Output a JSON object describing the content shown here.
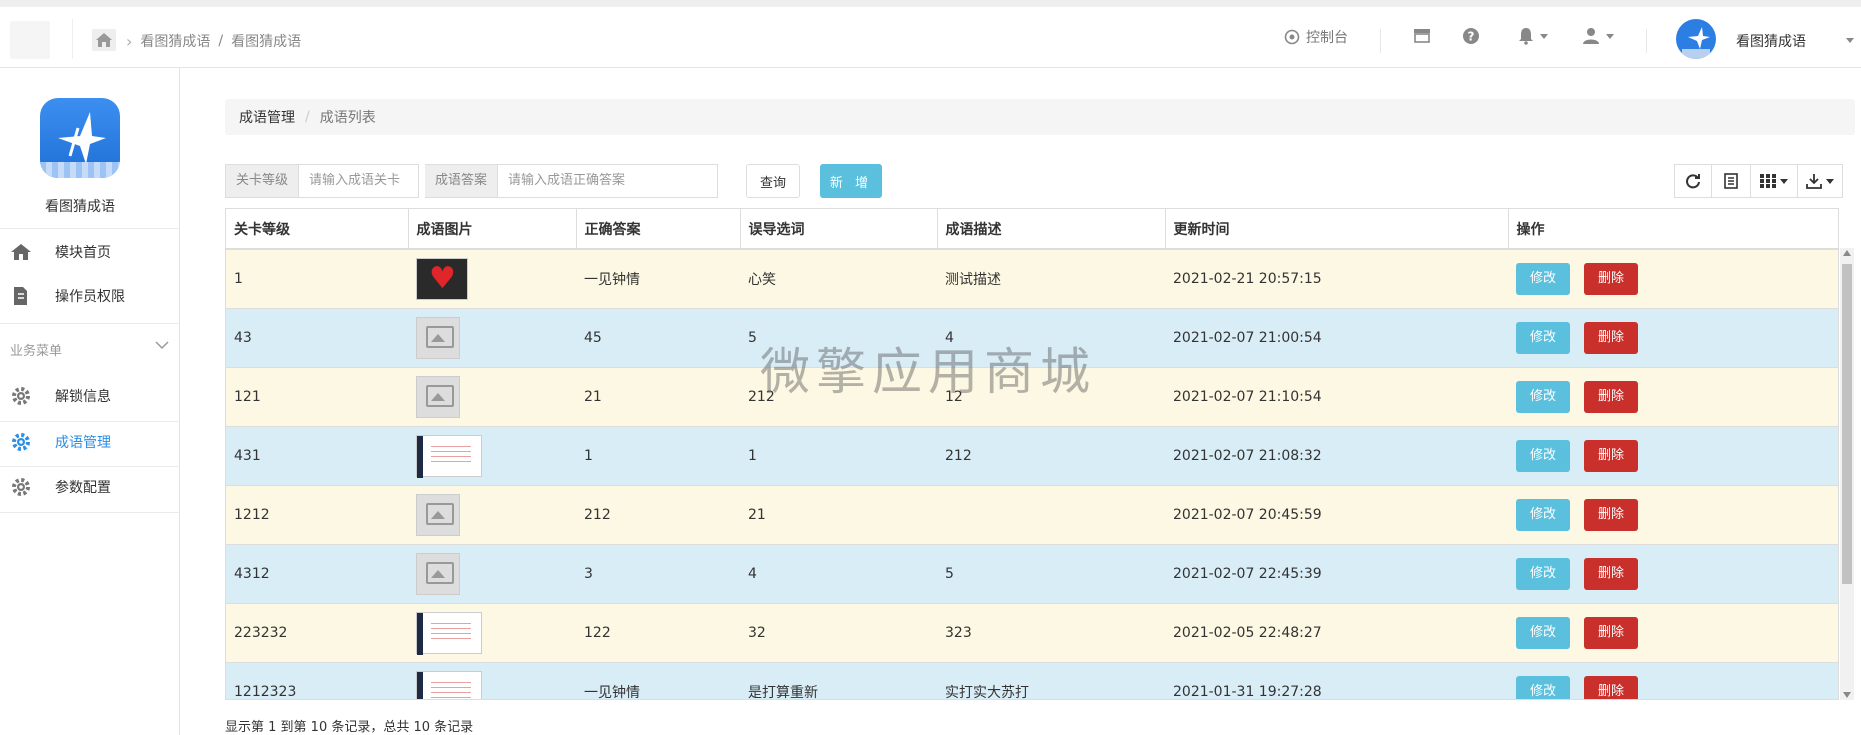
{
  "topbar": {
    "breadcrumb": [
      "看图猜成语",
      "看图猜成语"
    ],
    "console_label": "控制台",
    "user_name": "看图猜成语"
  },
  "sidebar": {
    "app_name": "看图猜成语",
    "items": [
      {
        "label": "模块首页",
        "icon": "home-icon"
      },
      {
        "label": "操作员权限",
        "icon": "file-edit-icon"
      }
    ],
    "section_label": "业务菜单",
    "business_items": [
      {
        "label": "解锁信息",
        "icon": "gear-icon"
      },
      {
        "label": "成语管理",
        "icon": "gear-icon",
        "active": true
      },
      {
        "label": "参数配置",
        "icon": "gear-icon"
      }
    ]
  },
  "main": {
    "breadcrumb": {
      "parent": "成语管理",
      "current": "成语列表"
    },
    "filters": [
      {
        "label": "关卡等级",
        "placeholder": "请输入成语关卡"
      },
      {
        "label": "成语答案",
        "placeholder": "请输入成语正确答案"
      }
    ],
    "query_label": "查询",
    "add_label": "新 增",
    "columns": [
      "关卡等级",
      "成语图片",
      "正确答案",
      "误导选词",
      "成语描述",
      "更新时间",
      "操作"
    ],
    "rows": [
      {
        "level": "1",
        "image": "heart",
        "answer": "一见钟情",
        "mislead": "心笑",
        "desc": "测试描述",
        "time": "2021-02-21 20:57:15"
      },
      {
        "level": "43",
        "image": "placeholder",
        "answer": "45",
        "mislead": "5",
        "desc": "4",
        "time": "2021-02-07 21:00:54"
      },
      {
        "level": "121",
        "image": "placeholder",
        "answer": "21",
        "mislead": "212",
        "desc": "12",
        "time": "2021-02-07 21:10:54"
      },
      {
        "level": "431",
        "image": "screenshot",
        "answer": "1",
        "mislead": "1",
        "desc": "212",
        "time": "2021-02-07 21:08:32"
      },
      {
        "level": "1212",
        "image": "placeholder",
        "answer": "212",
        "mislead": "21",
        "desc": "",
        "time": "2021-02-07 20:45:59"
      },
      {
        "level": "4312",
        "image": "placeholder",
        "answer": "3",
        "mislead": "4",
        "desc": "5",
        "time": "2021-02-07 22:45:39"
      },
      {
        "level": "223232",
        "image": "screenshot",
        "answer": "122",
        "mislead": "32",
        "desc": "323",
        "time": "2021-02-05 22:48:27"
      },
      {
        "level": "1212323",
        "image": "screenshot",
        "answer": "一见钟情",
        "mislead": "是打算重新",
        "desc": "实打实大苏打",
        "time": "2021-01-31 19:27:28"
      }
    ],
    "edit_label": "修改",
    "delete_label": "删除",
    "footer": "显示第 1 到第 10 条记录，总共 10 条记录"
  },
  "watermark": "微擎应用商城",
  "colors": {
    "accent": "#2b8ee6",
    "info": "#5bc0de",
    "danger": "#c9302c",
    "row_yellow": "#fcf8e3",
    "row_blue": "#d9edf7"
  }
}
